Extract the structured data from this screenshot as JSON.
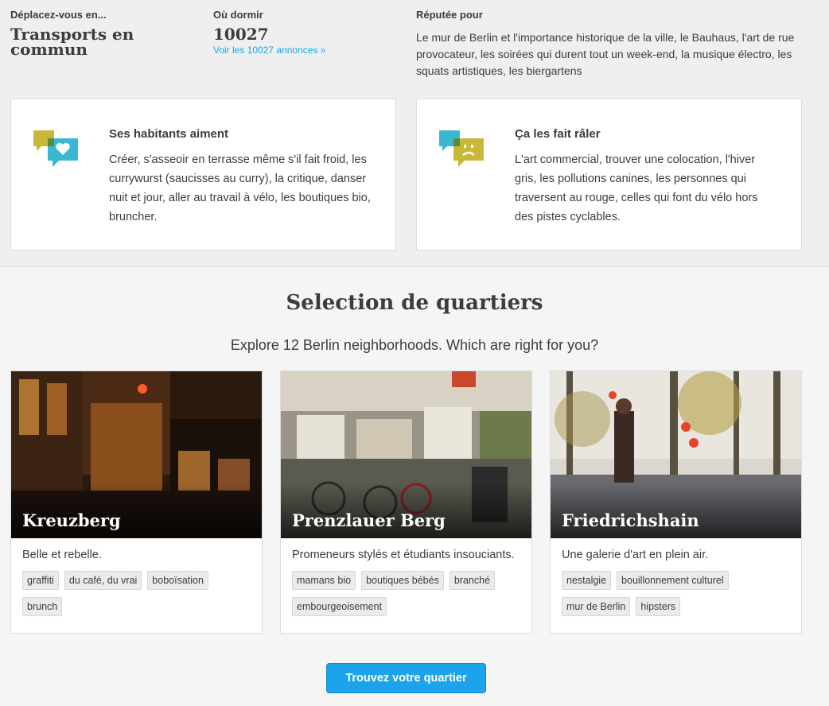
{
  "stats": {
    "transport": {
      "label": "Déplacez-vous en...",
      "value_line1": "Transports en",
      "value_line2": "commun"
    },
    "stay": {
      "label": "Où dormir",
      "value": "10027",
      "link": "Voir les 10027 annonces »"
    },
    "famous": {
      "label": "Réputée pour",
      "text": "Le mur de Berlin et l'importance historique de la ville, le Bauhaus, l'art de rue provocateur, les soirées qui durent tout un week-end, la musique électro, les squats artistiques, les biergartens"
    }
  },
  "cards": {
    "love": {
      "title": "Ses habitants aiment",
      "text": "Créer, s'asseoir en terrasse même s'il fait froid, les currywurst (saucisses au curry), la critique, danser nuit et jour, aller au travail à vélo, les boutiques bio, bruncher.",
      "icon": "heart-speech-icon"
    },
    "hate": {
      "title": "Ça les fait râler",
      "text": "L'art commercial, trouver une colocation, l'hiver gris, les pollutions canines, les personnes qui traversent au rouge, celles qui font du vélo hors des pistes cyclables.",
      "icon": "frown-speech-icon"
    }
  },
  "section": {
    "title": "Selection de quartiers",
    "subtitle": "Explore 12 Berlin neighborhoods. Which are right for you?"
  },
  "neighborhoods": [
    {
      "name": "Kreuzberg",
      "desc": "Belle et rebelle.",
      "tags": [
        "graffiti",
        "du café, du vrai",
        "boboïsation",
        "brunch"
      ]
    },
    {
      "name": "Prenzlauer Berg",
      "desc": "Promeneurs stylés et étudiants insouciants.",
      "tags": [
        "mamans bio",
        "boutiques bébés",
        "branché",
        "embourgeoisement"
      ]
    },
    {
      "name": "Friedrichshain",
      "desc": "Une galerie d'art en plein air.",
      "tags": [
        "nestalgie",
        "bouillonnement culturel",
        "mur de Berlin",
        "hipsters"
      ]
    }
  ],
  "cta": {
    "label": "Trouvez votre quartier"
  },
  "colors": {
    "accent": "#1ba3ec",
    "link": "#1ba8e6",
    "icon_teal": "#3ab7d1",
    "icon_yellow": "#c8b83a"
  }
}
